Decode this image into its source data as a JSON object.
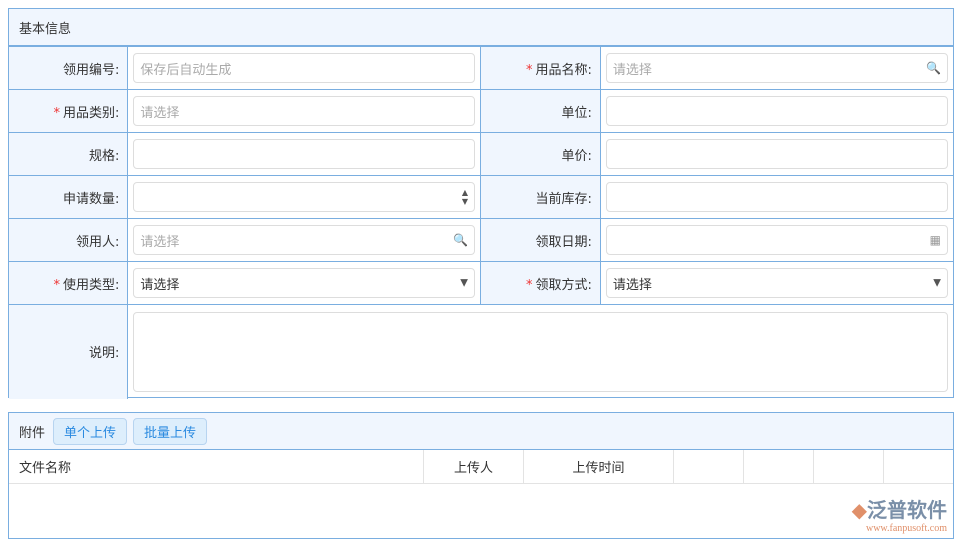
{
  "basic": {
    "title": "基本信息",
    "fields": {
      "code": {
        "label": "领用编号:",
        "placeholder": "保存后自动生成"
      },
      "item_name": {
        "label": "用品名称:",
        "placeholder": "请选择"
      },
      "category": {
        "label": "用品类别:",
        "placeholder": "请选择"
      },
      "unit": {
        "label": "单位:"
      },
      "spec": {
        "label": "规格:"
      },
      "price": {
        "label": "单价:"
      },
      "qty": {
        "label": "申请数量:"
      },
      "stock": {
        "label": "当前库存:"
      },
      "user": {
        "label": "领用人:",
        "placeholder": "请选择"
      },
      "date": {
        "label": "领取日期:"
      },
      "use_type": {
        "label": "使用类型:",
        "value": "请选择"
      },
      "method": {
        "label": "领取方式:",
        "value": "请选择"
      },
      "desc": {
        "label": "说明:"
      }
    },
    "required_mark": "*"
  },
  "attachments": {
    "title": "附件",
    "single_upload": "单个上传",
    "batch_upload": "批量上传",
    "columns": [
      "文件名称",
      "上传人",
      "上传时间",
      "",
      "",
      "",
      ""
    ]
  },
  "logo": {
    "name": "泛普软件",
    "url": "www.fanpusoft.com"
  }
}
